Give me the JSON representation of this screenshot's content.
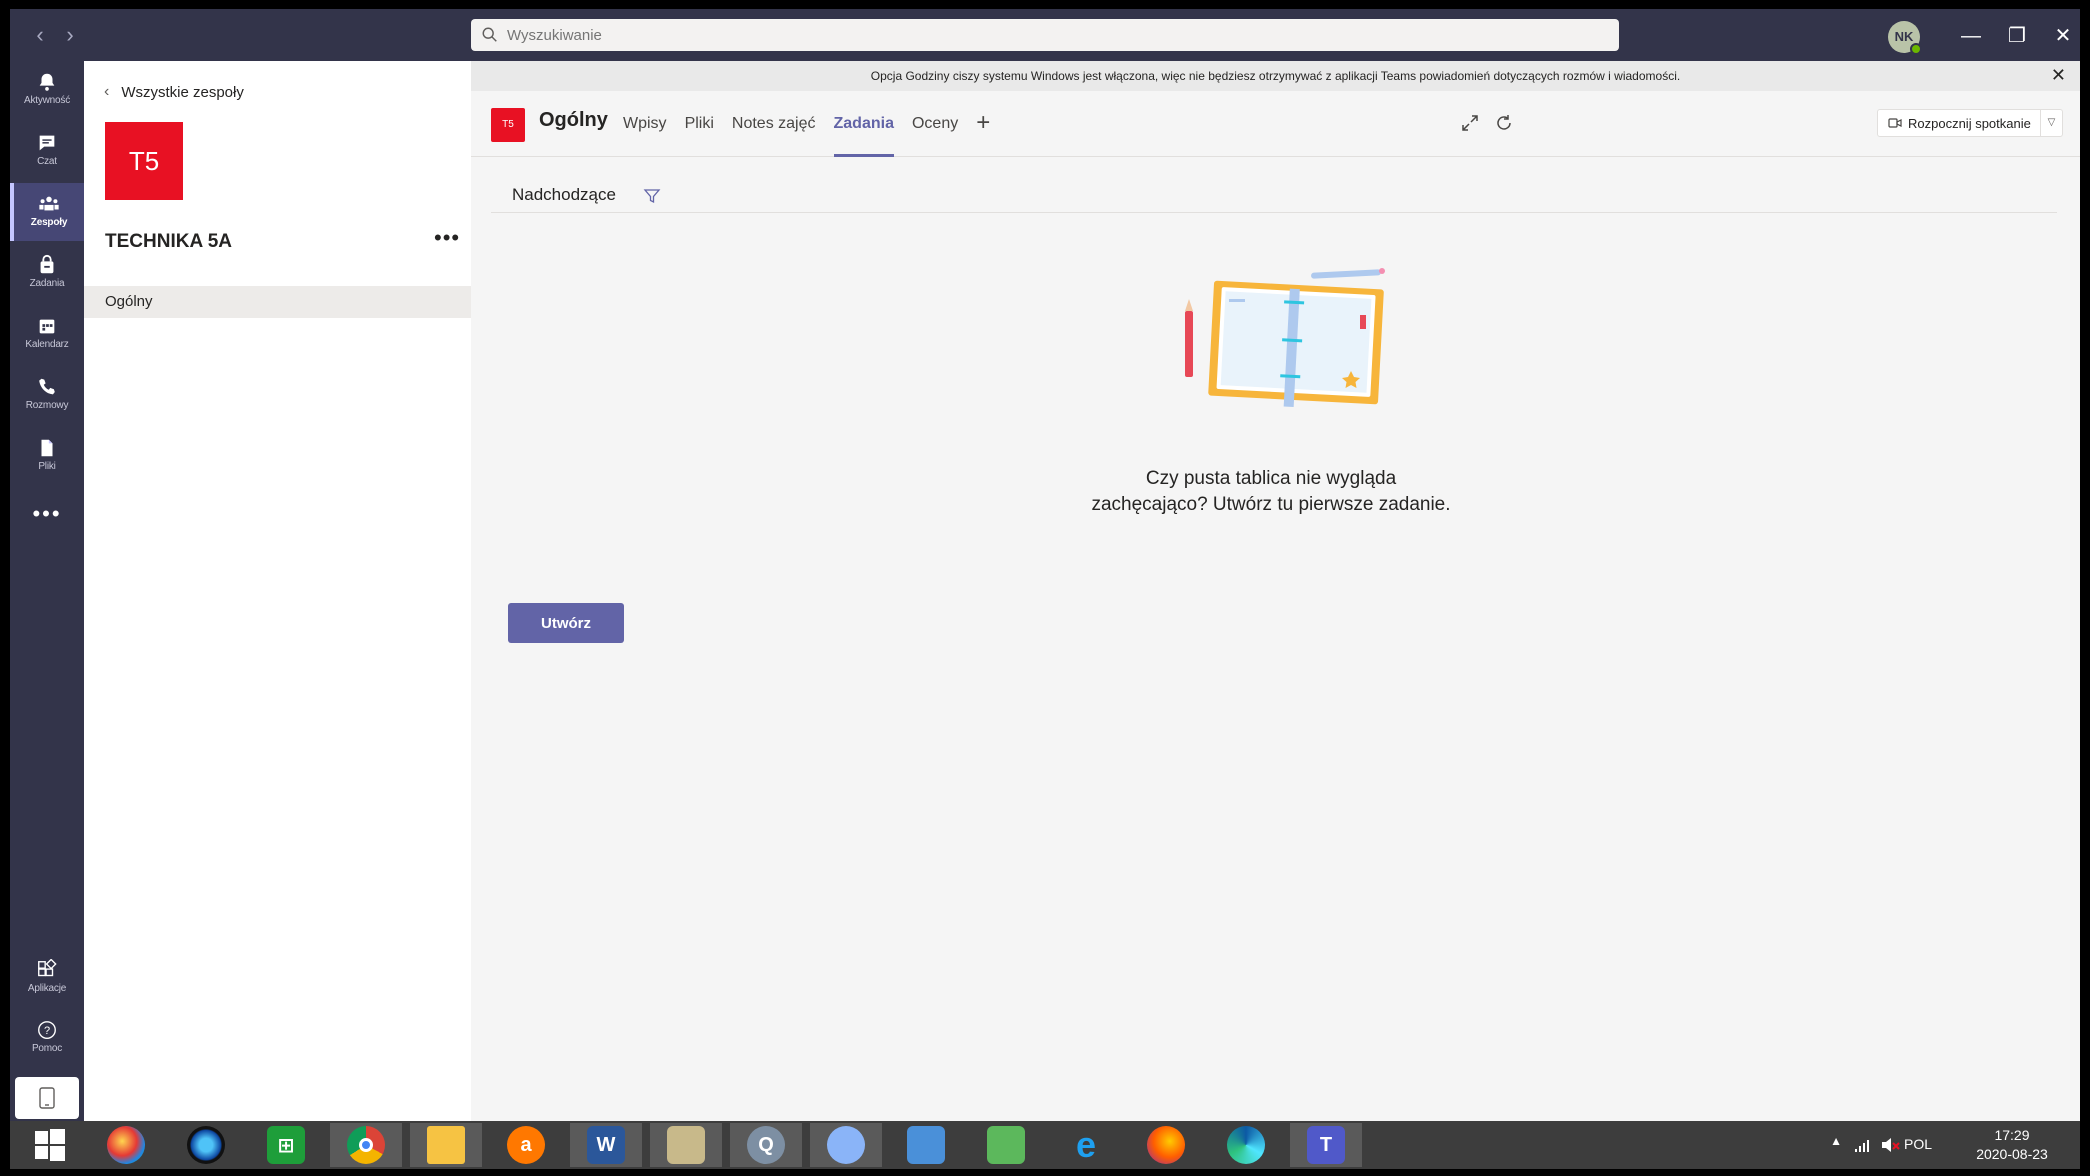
{
  "search": {
    "placeholder": "Wyszukiwanie"
  },
  "user": {
    "initials": "NK"
  },
  "window": {
    "minimize": "—",
    "restore": "❐",
    "close": "✕"
  },
  "rail": {
    "items": [
      {
        "id": "activity",
        "label": "Aktywność"
      },
      {
        "id": "chat",
        "label": "Czat"
      },
      {
        "id": "teams",
        "label": "Zespoły"
      },
      {
        "id": "assignments",
        "label": "Zadania"
      },
      {
        "id": "calendar",
        "label": "Kalendarz"
      },
      {
        "id": "calls",
        "label": "Rozmowy"
      },
      {
        "id": "files",
        "label": "Pliki"
      }
    ],
    "more": "•••",
    "bottom": [
      {
        "id": "apps",
        "label": "Aplikacje"
      },
      {
        "id": "help",
        "label": "Pomoc"
      }
    ]
  },
  "team": {
    "back_label": "Wszystkie zespoły",
    "tile": "T5",
    "name": "TECHNIKA 5A",
    "more": "•••",
    "channels": [
      {
        "name": "Ogólny"
      }
    ]
  },
  "notice": {
    "text": "Opcja Godziny ciszy systemu Windows jest włączona, więc nie będziesz otrzymywać z aplikacji Teams powiadomień dotyczących rozmów i wiadomości."
  },
  "channel": {
    "tile": "T5",
    "title": "Ogólny",
    "tabs": [
      {
        "label": "Wpisy"
      },
      {
        "label": "Pliki"
      },
      {
        "label": "Notes zajęć"
      },
      {
        "label": "Zadania",
        "active": true
      },
      {
        "label": "Oceny"
      }
    ],
    "add_tab": "+",
    "meet_label": "Rozpocznij spotkanie"
  },
  "assignments": {
    "filter_label": "Nadchodzące",
    "empty_text": "Czy pusta tablica nie wygląda zachęcająco? Utwórz tu pierwsze zadanie.",
    "create_label": "Utwórz"
  },
  "taskbar": {
    "language": "POL",
    "time": "17:29",
    "date": "2020-08-23"
  },
  "colors": {
    "accent": "#6264a7",
    "team_tile": "#e81123",
    "rail_bg": "#33344a"
  }
}
